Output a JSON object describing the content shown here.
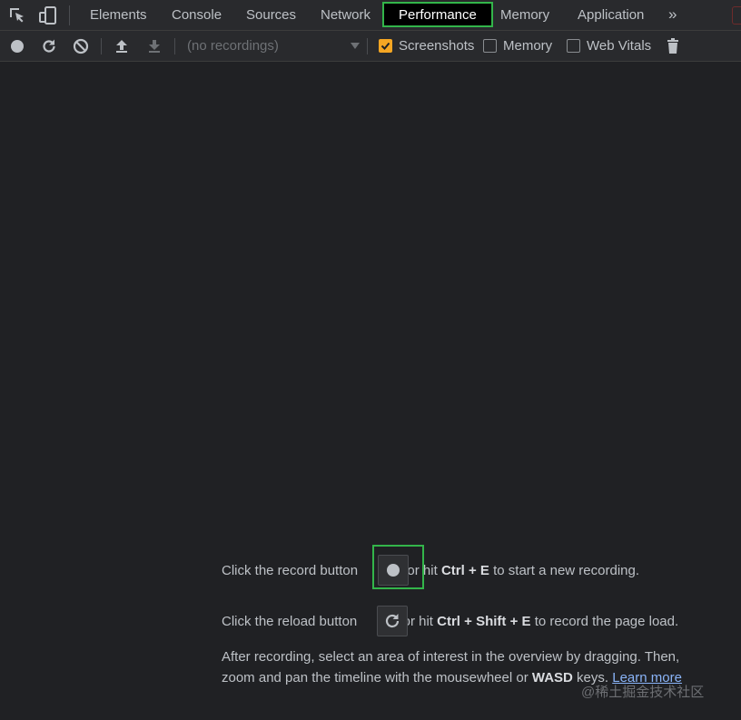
{
  "tabs": {
    "items": [
      {
        "label": "Elements"
      },
      {
        "label": "Console"
      },
      {
        "label": "Sources"
      },
      {
        "label": "Network"
      },
      {
        "label": "Performance",
        "active": true
      },
      {
        "label": "Memory"
      },
      {
        "label": "Application"
      }
    ],
    "more_label": "»"
  },
  "toolbar": {
    "recordings_placeholder": "(no recordings)",
    "screenshots_label": "Screenshots",
    "screenshots_checked": true,
    "memory_label": "Memory",
    "memory_checked": false,
    "web_vitals_label": "Web Vitals",
    "web_vitals_checked": false
  },
  "landing": {
    "record_prefix": "Click the record button",
    "record_mid": "or hit",
    "record_key1": "Ctrl",
    "plus": "+",
    "record_key2": "E",
    "record_suffix": "to start a new recording.",
    "reload_prefix": "Click the reload button",
    "reload_mid": "or hit",
    "reload_key1": "Ctrl",
    "reload_key2": "Shift",
    "reload_key3": "E",
    "reload_suffix": "to record the page load.",
    "after_line1": "After recording, select an area of interest in the overview by dragging. Then,",
    "after_line2_prefix": "zoom and pan the timeline with the mousewheel or",
    "after_wasd": "WASD",
    "after_keys": "keys.",
    "learn_more": "Learn more"
  },
  "watermark": "@稀土掘金技术社区",
  "colors": {
    "background": "#202124",
    "highlight": "#33b54a",
    "checkbox_checked": "#f5a623",
    "link": "#8ab4f8"
  }
}
